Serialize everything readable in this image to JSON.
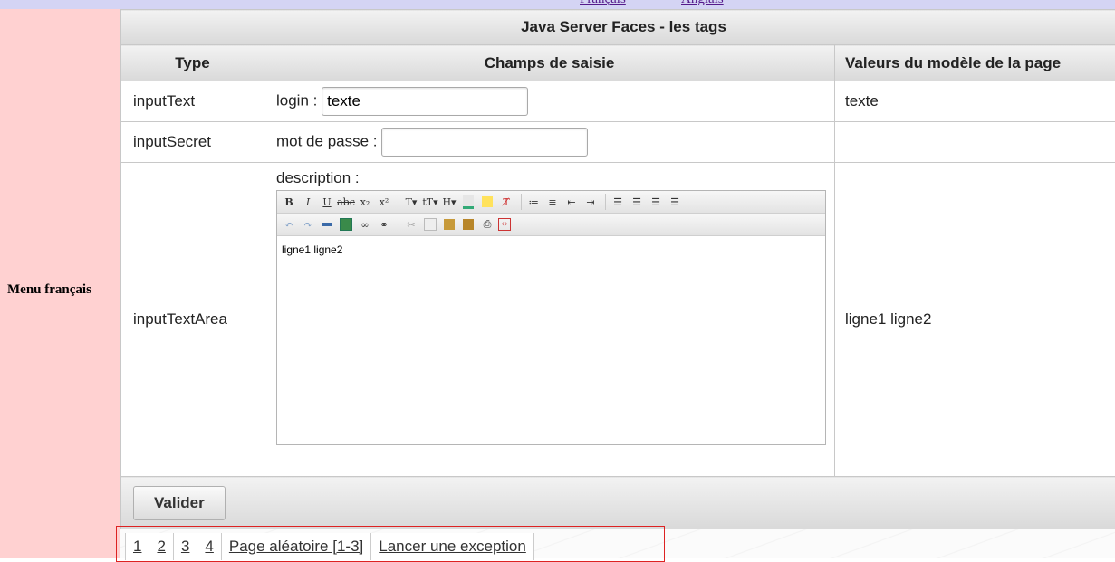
{
  "languages": [
    "Français",
    "Anglais"
  ],
  "sidebar": {
    "menu_title": "Menu français"
  },
  "table": {
    "caption": "Java Server Faces - les tags",
    "headers": [
      "Type",
      "Champs de saisie",
      "Valeurs du modèle de la page"
    ],
    "rows": [
      {
        "type": "inputText",
        "field_label": "login :",
        "field_value": "texte",
        "model_value": "texte"
      },
      {
        "type": "inputSecret",
        "field_label": "mot de passe :",
        "field_value": "",
        "model_value": ""
      },
      {
        "type": "inputTextArea",
        "field_label": "description :",
        "field_value": "ligne1 ligne2",
        "model_value": "ligne1 ligne2"
      }
    ],
    "submit_label": "Valider"
  },
  "editor_toolbar": {
    "row1": [
      "bold-icon",
      "italic-icon",
      "underline-icon",
      "strikethrough-icon",
      "subscript-icon",
      "superscript-icon",
      "font-family-icon",
      "font-size-icon",
      "heading-icon",
      "text-color-icon",
      "highlight-icon",
      "clear-format-icon",
      "unordered-list-icon",
      "ordered-list-icon",
      "outdent-icon",
      "indent-icon",
      "align-left-icon",
      "align-center-icon",
      "align-right-icon",
      "justify-icon"
    ],
    "row2": [
      "undo-icon",
      "redo-icon",
      "horizontal-rule-icon",
      "image-icon",
      "link-icon",
      "unlink-icon",
      "cut-icon",
      "copy-icon",
      "paste-icon",
      "paste-text-icon",
      "print-icon",
      "source-icon"
    ]
  },
  "pager": {
    "links": [
      "1",
      "2",
      "3",
      "4",
      "Page aléatoire [1-3]",
      "Lancer une exception"
    ]
  },
  "colors": {
    "sidebar_bg": "#ffd1d1",
    "topbar_bg": "#d4d4f4",
    "pager_border": "#dd2222"
  }
}
